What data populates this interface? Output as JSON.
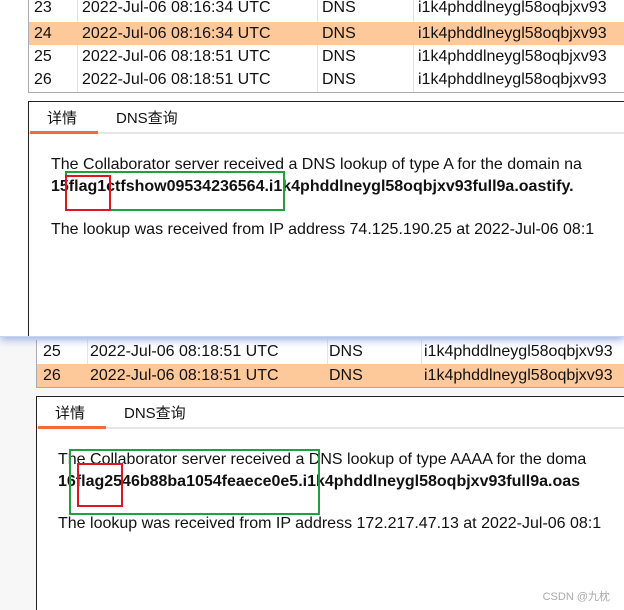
{
  "screenshot1": {
    "rows": [
      {
        "num": "23",
        "time": "2022-Jul-06 08:16:34 UTC",
        "type": "DNS",
        "payload": "i1k4phddlneygl58oqbjxv93",
        "selected": false
      },
      {
        "num": "24",
        "time": "2022-Jul-06 08:16:34 UTC",
        "type": "DNS",
        "payload": "i1k4phddlneygl58oqbjxv93",
        "selected": true
      },
      {
        "num": "25",
        "time": "2022-Jul-06 08:18:51 UTC",
        "type": "DNS",
        "payload": "i1k4phddlneygl58oqbjxv93",
        "selected": false
      },
      {
        "num": "26",
        "time": "2022-Jul-06 08:18:51 UTC",
        "type": "DNS",
        "payload": "i1k4phddlneygl58oqbjxv93",
        "selected": false
      }
    ],
    "tabs": [
      "详情",
      "DNS查询"
    ],
    "line1": "The Collaborator server received a DNS lookup of type A for the domain na",
    "line2": "15flag1ctfshow09534236564.i1k4phddlneygl58oqbjxv93full9a.oastify.",
    "line3": "The lookup was received from IP address 74.125.190.25 at 2022-Jul-06 08:1"
  },
  "screenshot2": {
    "rows": [
      {
        "num": "25",
        "time": "2022-Jul-06 08:18:51 UTC",
        "type": "DNS",
        "payload": "i1k4phddlneygl58oqbjxv93",
        "selected": false
      },
      {
        "num": "26",
        "time": "2022-Jul-06 08:18:51 UTC",
        "type": "DNS",
        "payload": "i1k4phddlneygl58oqbjxv93",
        "selected": true
      }
    ],
    "tabs": [
      "详情",
      "DNS查询"
    ],
    "line1": "The Collaborator server received a DNS lookup of type AAAA for the doma",
    "line2": "16flag2546b88ba1054feaece0e5.i1k4phddlneygl58oqbjxv93full9a.oas",
    "line3": "The lookup was received from IP address 172.217.47.13 at 2022-Jul-06 08:1"
  },
  "watermark": "CSDN @九枕",
  "colors": {
    "selected_row": "#fdc89a",
    "tab_underline": "#f26b3a",
    "highlight_green": "#22a03c",
    "highlight_red": "#e0161e"
  }
}
